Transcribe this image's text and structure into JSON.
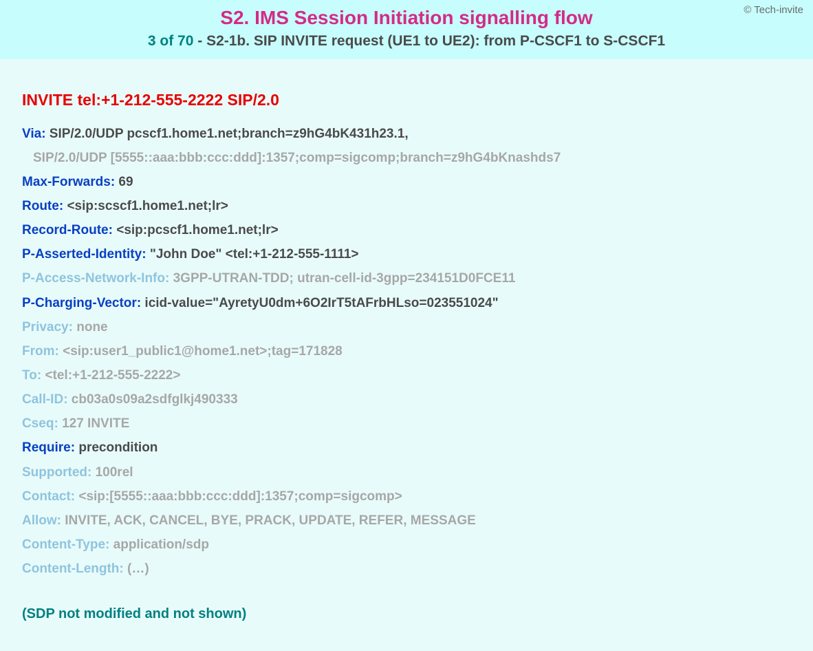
{
  "copyright": "© Tech-invite",
  "header": {
    "title": "S2. IMS Session Initiation signalling flow",
    "sub_num": "3 of 70",
    "sub_rest": " - S2-1b. SIP INVITE request (UE1 to UE2): from P-CSCF1 to S-CSCF1"
  },
  "invite": {
    "method": "INVITE",
    "uri": "tel:+1-212-555-2222 SIP/2.0"
  },
  "via": {
    "name": "Via",
    "line1": "SIP/2.0/UDP pcscf1.home1.net;branch=z9hG4bK431h23.1,",
    "line2": "SIP/2.0/UDP [5555::aaa:bbb:ccc:ddd]:1357;comp=sigcomp;branch=z9hG4bKnashds7"
  },
  "maxForwards": {
    "name": "Max-Forwards",
    "value": "69"
  },
  "route": {
    "name": "Route",
    "value": "<sip:scscf1.home1.net;lr>"
  },
  "recordRoute": {
    "name": "Record-Route",
    "value": "<sip:pcscf1.home1.net;lr>"
  },
  "pAsserted": {
    "name": "P-Asserted-Identity",
    "value": "\"John Doe\" <tel:+1-212-555-1111>"
  },
  "pAccess": {
    "name": "P-Access-Network-Info",
    "value": "3GPP-UTRAN-TDD; utran-cell-id-3gpp=234151D0FCE11"
  },
  "pCharging": {
    "name": "P-Charging-Vector",
    "value": "icid-value=\"AyretyU0dm+6O2IrT5tAFrbHLso=023551024\""
  },
  "privacy": {
    "name": "Privacy",
    "value": "none"
  },
  "from": {
    "name": "From",
    "value": "<sip:user1_public1@home1.net>;tag=171828"
  },
  "to": {
    "name": "To",
    "value": "<tel:+1-212-555-2222>"
  },
  "callId": {
    "name": "Call-ID",
    "value": "cb03a0s09a2sdfglkj490333"
  },
  "cseq": {
    "name": "Cseq",
    "value": "127 INVITE"
  },
  "require": {
    "name": "Require",
    "value": "precondition"
  },
  "supported": {
    "name": "Supported",
    "value": "100rel"
  },
  "contact": {
    "name": "Contact",
    "value": "<sip:[5555::aaa:bbb:ccc:ddd]:1357;comp=sigcomp>"
  },
  "allow": {
    "name": "Allow",
    "value": "INVITE, ACK, CANCEL, BYE, PRACK, UPDATE, REFER, MESSAGE"
  },
  "contentType": {
    "name": "Content-Type",
    "value": "application/sdp"
  },
  "contentLength": {
    "name": "Content-Length",
    "value": "(…)"
  },
  "sdpNote": "(SDP not modified and not shown)"
}
